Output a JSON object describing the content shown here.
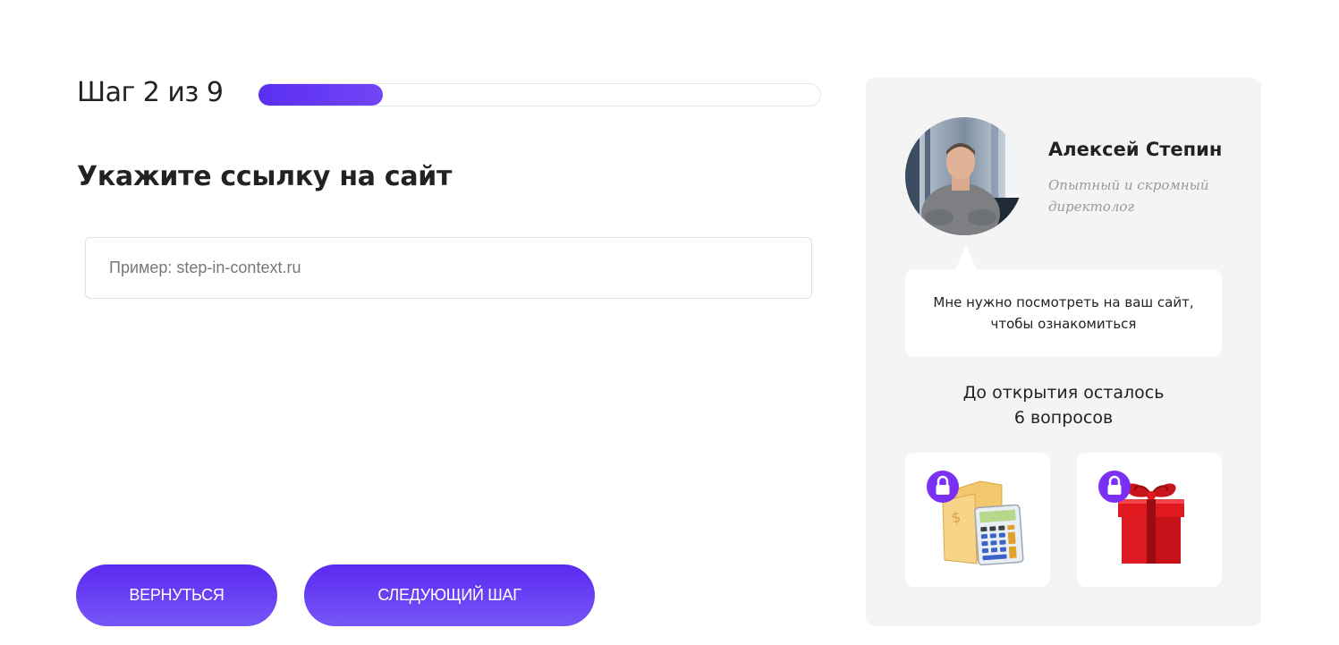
{
  "progress": {
    "step_label": "Шаг 2 из 9",
    "current": 2,
    "total": 9,
    "fill_fraction": 0.222,
    "accent_color": "#5b2af0"
  },
  "question": {
    "title": "Укажите ссылку на сайт",
    "input_value": "",
    "input_placeholder": "Пример: step-in-context.ru"
  },
  "navigation": {
    "back_label": "ВЕРНУТЬСЯ",
    "next_label": "СЛЕДУЮЩИЙ ШАГ"
  },
  "sidebar": {
    "manager": {
      "name": "Алексей Степин",
      "role": "Опытный и скромный директолог"
    },
    "message": "Мне нужно посмотреть на ваш сайт, чтобы ознакомиться",
    "remaining_line1": "До открытия осталось",
    "remaining_line2": "6 вопросов",
    "bonuses": [
      {
        "icon": "calculator-folder-icon",
        "locked": true
      },
      {
        "icon": "gift-box-icon",
        "locked": true
      }
    ]
  }
}
